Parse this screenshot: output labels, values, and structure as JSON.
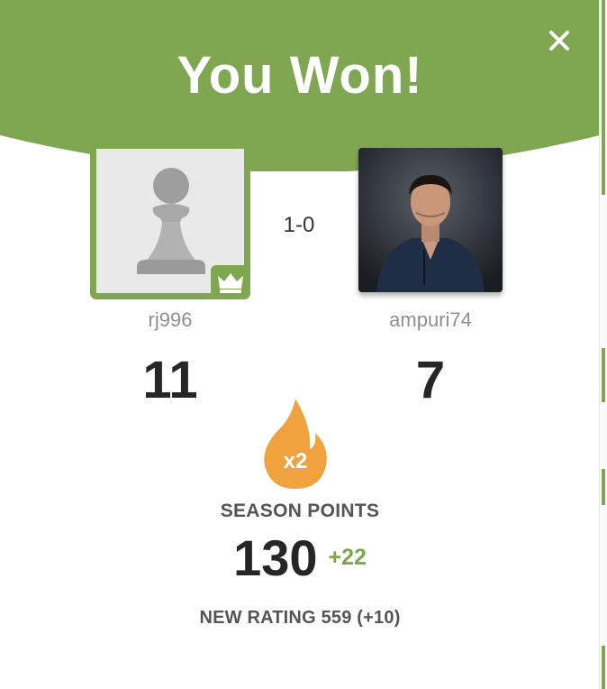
{
  "header": {
    "title": "You Won!",
    "close_icon": "close-icon"
  },
  "result": {
    "score": "1-0"
  },
  "players": [
    {
      "username": "rj996",
      "rating": "11",
      "avatar_icon": "pawn-icon",
      "badge_icon": "crown-icon",
      "winner": true
    },
    {
      "username": "ampuri74",
      "rating": "7",
      "avatar_icon": "person-photo"
    }
  ],
  "season": {
    "multiplier": "x2",
    "multiplier_icon": "flame-icon",
    "label": "SEASON POINTS",
    "points": "130",
    "delta": "+22"
  },
  "new_rating": "NEW RATING 559 (+10)",
  "colors": {
    "accent_green": "#7fa650",
    "flame_orange": "#f0a33c",
    "text_dark": "#262626",
    "text_muted": "#8f8f8f"
  }
}
